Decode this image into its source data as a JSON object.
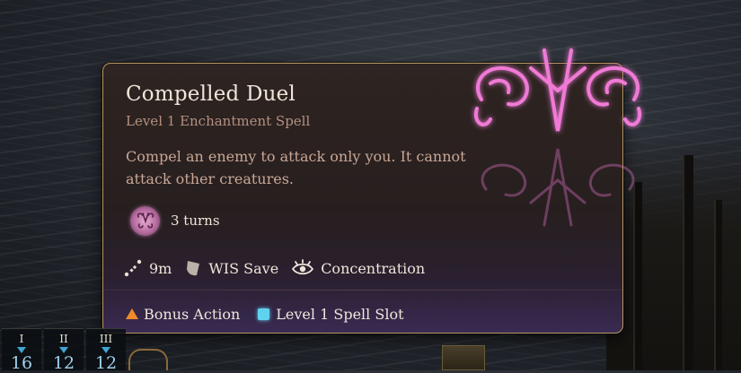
{
  "tooltip": {
    "title": "Compelled Duel",
    "subtitle": "Level 1 Enchantment Spell",
    "description": "Compel an enemy to attack only you. It cannot attack other creatures.",
    "duration": {
      "icon": "compelled-duel-icon",
      "label": "3 turns"
    },
    "properties": [
      {
        "icon": "range-icon",
        "label": "9m"
      },
      {
        "icon": "shield-save-icon",
        "label": "WIS Save"
      },
      {
        "icon": "concentration-eye-icon",
        "label": "Concentration"
      }
    ],
    "costs": [
      {
        "icon": "bonus-action-triangle-icon",
        "label": "Bonus Action",
        "color": "#f08a2a"
      },
      {
        "icon": "spell-slot-square-icon",
        "label": "Level 1 Spell Slot",
        "color": "#5fd2f0"
      }
    ],
    "accent_color": "#b89863",
    "spell_glow_color": "#f07ad6"
  },
  "hotbar": {
    "spell_slots": [
      {
        "level": "I",
        "count": "16"
      },
      {
        "level": "II",
        "count": "12"
      },
      {
        "level": "III",
        "count": "12"
      }
    ]
  }
}
